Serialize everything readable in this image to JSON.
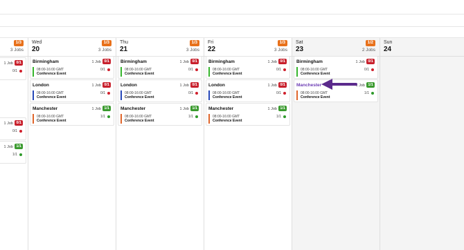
{
  "days": [
    {
      "dow": "",
      "date": "",
      "badge": "1/3",
      "jobs": "3 Jobs",
      "rows": [
        {
          "location": "",
          "job_count": "1 Job",
          "count_badge": "0/1",
          "badge_color": "red",
          "time": "",
          "event": "",
          "ratio": "0/1",
          "dot": "red",
          "bar": "none"
        },
        {
          "location": "",
          "job_count": "1 Job",
          "count_badge": "0/1",
          "badge_color": "red",
          "time": "",
          "event": "",
          "ratio": "0/1",
          "dot": "red",
          "bar": "none"
        },
        {
          "location": "",
          "job_count": "1 Job",
          "count_badge": "1/1",
          "badge_color": "green",
          "time": "",
          "event": "",
          "ratio": "1/1",
          "dot": "green",
          "bar": "none"
        }
      ]
    },
    {
      "dow": "Wed",
      "date": "20",
      "badge": "1/3",
      "jobs": "3 Jobs",
      "rows": [
        {
          "location": "Birmingham",
          "job_count": "1 Job",
          "count_badge": "0/1",
          "badge_color": "red",
          "time": "08:00-16:00 GMT",
          "event": "Conference Event",
          "ratio": "0/1",
          "dot": "red",
          "bar": "green"
        },
        {
          "location": "London",
          "job_count": "1 Job",
          "count_badge": "0/1",
          "badge_color": "red",
          "time": "08:00-16:00 GMT",
          "event": "Conference Event",
          "ratio": "0/1",
          "dot": "red",
          "bar": "blue"
        },
        {
          "location": "Manchester",
          "job_count": "1 Job",
          "count_badge": "1/1",
          "badge_color": "green",
          "time": "08:00-16:00 GMT",
          "event": "Conference Event",
          "ratio": "1/1",
          "dot": "green",
          "bar": "orange"
        }
      ]
    },
    {
      "dow": "Thu",
      "date": "21",
      "badge": "1/3",
      "jobs": "3 Jobs",
      "rows": [
        {
          "location": "Birmingham",
          "job_count": "1 Job",
          "count_badge": "0/1",
          "badge_color": "red",
          "time": "08:00-16:00 GMT",
          "event": "Conference Event",
          "ratio": "0/1",
          "dot": "red",
          "bar": "green"
        },
        {
          "location": "London",
          "job_count": "1 Job",
          "count_badge": "0/1",
          "badge_color": "red",
          "time": "08:00-16:00 GMT",
          "event": "Conference Event",
          "ratio": "0/1",
          "dot": "red",
          "bar": "blue"
        },
        {
          "location": "Manchester",
          "job_count": "1 Job",
          "count_badge": "1/1",
          "badge_color": "green",
          "time": "08:00-16:00 GMT",
          "event": "Conference Event",
          "ratio": "1/1",
          "dot": "green",
          "bar": "orange"
        }
      ]
    },
    {
      "dow": "Fri",
      "date": "22",
      "badge": "1/3",
      "jobs": "3 Jobs",
      "rows": [
        {
          "location": "Birmingham",
          "job_count": "1 Job",
          "count_badge": "0/1",
          "badge_color": "red",
          "time": "08:00-16:00 GMT",
          "event": "Conference Event",
          "ratio": "0/1",
          "dot": "red",
          "bar": "green"
        },
        {
          "location": "London",
          "job_count": "1 Job",
          "count_badge": "0/1",
          "badge_color": "red",
          "time": "08:00-16:00 GMT",
          "event": "Conference Event",
          "ratio": "0/1",
          "dot": "red",
          "bar": "blue"
        },
        {
          "location": "Manchester",
          "job_count": "1 Job",
          "count_badge": "1/1",
          "badge_color": "green",
          "time": "08:00-16:00 GMT",
          "event": "Conference Event",
          "ratio": "1/1",
          "dot": "green",
          "bar": "orange"
        }
      ]
    },
    {
      "dow": "Sat",
      "date": "23",
      "badge": "1/2",
      "jobs": "2 Jobs",
      "rows": [
        {
          "location": "Birmingham",
          "job_count": "1 Job",
          "count_badge": "0/1",
          "badge_color": "red",
          "time": "08:00-16:00 GMT",
          "event": "Conference Event",
          "ratio": "0/1",
          "dot": "red",
          "bar": "green"
        },
        {
          "location": "Manchester",
          "job_count": "1 Job",
          "count_badge": "1/1",
          "badge_color": "green",
          "time": "08:00-16:00 GMT",
          "event": "Conference Event",
          "ratio": "1/1",
          "dot": "green",
          "bar": "orange",
          "link": true
        }
      ]
    },
    {
      "dow": "Sun",
      "date": "24",
      "badge": "",
      "jobs": "",
      "rows": []
    }
  ],
  "colors": {
    "badge_orange": "#e8711b",
    "badge_red": "#c8202c",
    "badge_green": "#3a9a2e",
    "arrow": "#5b2a8c",
    "link": "#6c3cb4"
  },
  "icons": {
    "arrow": "pointer-arrow-icon"
  }
}
